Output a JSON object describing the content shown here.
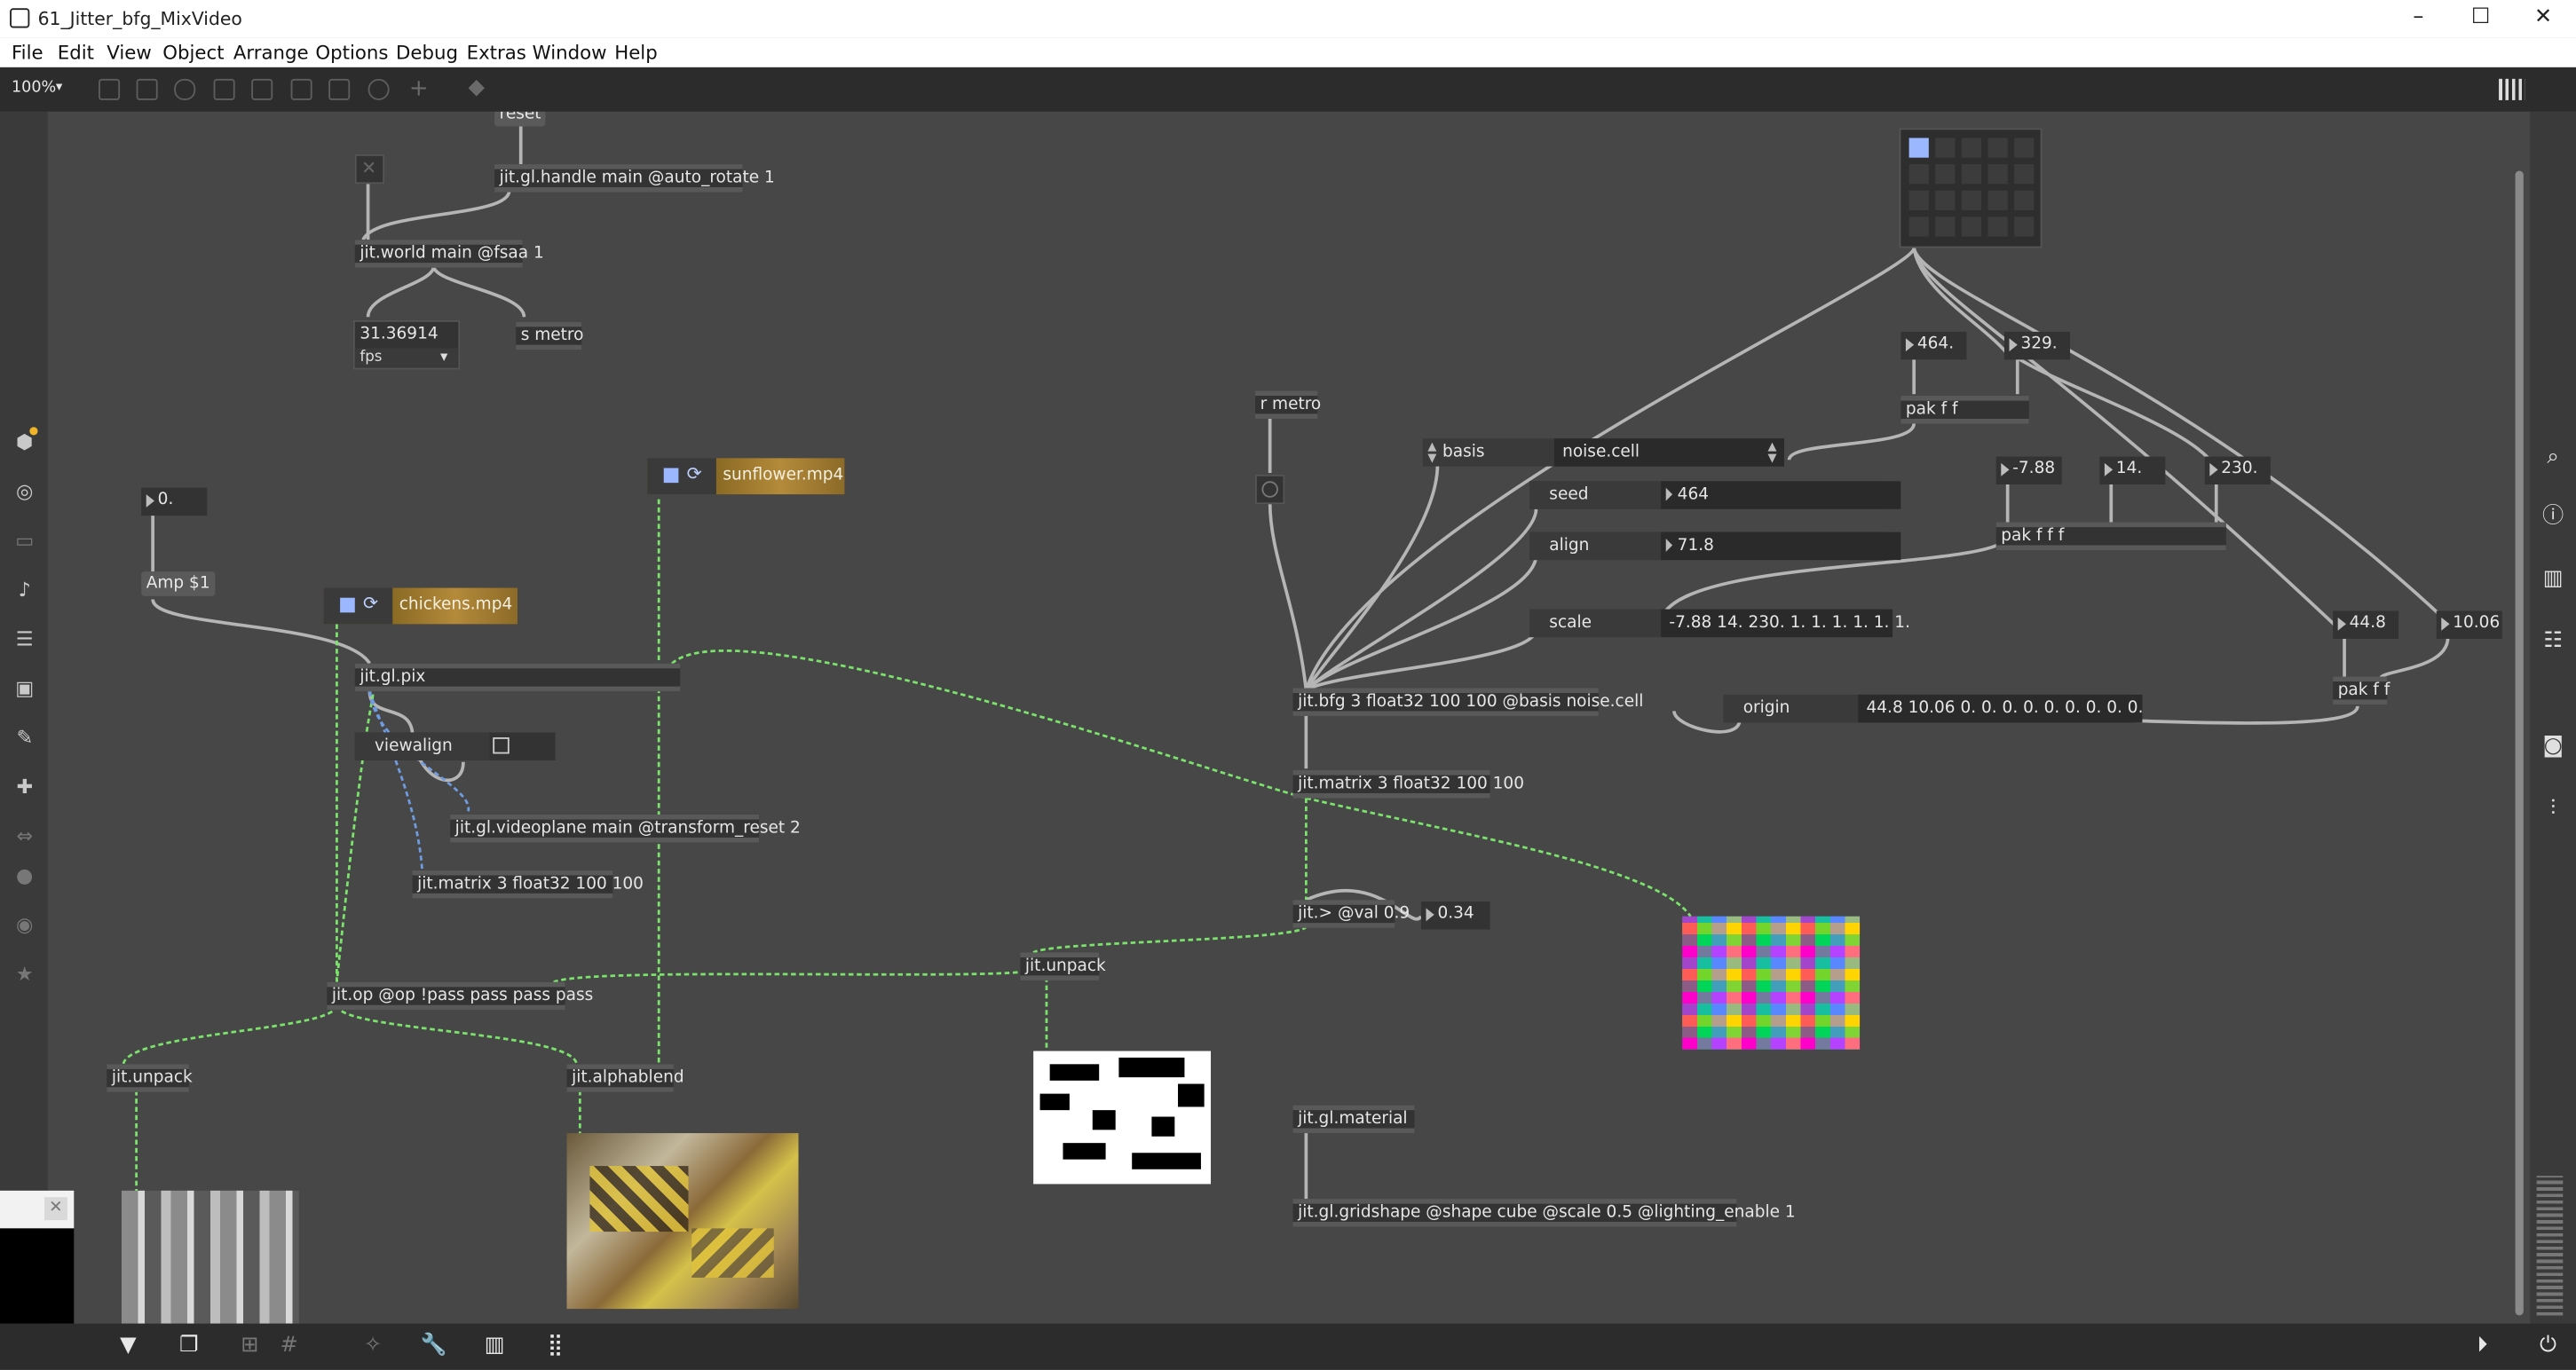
{
  "window": {
    "title": "61_Jitter_bfg_MixVideo",
    "buttons": [
      "–",
      "☐",
      "✕"
    ]
  },
  "menubar": [
    "File",
    "Edit",
    "View",
    "Object",
    "Arrange",
    "Options",
    "Debug",
    "Extras",
    "Window",
    "Help"
  ],
  "toolbar": {
    "zoom": "100%"
  },
  "objects": {
    "reset": "reset",
    "handle": "jit.gl.handle main @auto_rotate 1",
    "world": "jit.world main @fsaa 1",
    "fps_value": "31.36914",
    "fps_label": "fps",
    "s_metro": "s metro",
    "num_zero": "0.",
    "amp": "Amp $1",
    "sunflower": "sunflower.mp4",
    "chickens": "chickens.mp4",
    "pix": "jit.gl.pix",
    "viewalign": "viewalign",
    "videoplane": "jit.gl.videoplane main @transform_reset 2",
    "matrix_left": "jit.matrix 3 float32 100 100",
    "op": "jit.op @op !pass pass pass pass",
    "unpack_left": "jit.unpack",
    "alphablend": "jit.alphablend",
    "unpack_mid": "jit.unpack",
    "r_metro": "r metro",
    "basis_label": "basis",
    "basis_value": "noise.cell",
    "seed_label": "seed",
    "seed_value": "464",
    "align_label": "align",
    "align_value": "71.8",
    "scale_label": "scale",
    "scale_value": "-7.88 14. 230. 1. 1. 1. 1. 1. 1.",
    "bfg": "jit.bfg 3 float32 100 100 @basis noise.cell",
    "origin_label": "origin",
    "origin_value": "44.8 10.06 0. 0. 0. 0. 0. 0. 0. 0. 0.",
    "matrix_mid": "jit.matrix 3 float32 100 100",
    "gtval": "jit.> @val 0.9",
    "num_034": "0.34",
    "material": "jit.gl.material",
    "gridshape": "jit.gl.gridshape @shape cube @scale 0.5 @lighting_enable 1",
    "num_464": "464.",
    "num_329": "329.",
    "pakff_top": "pak f f",
    "num_m788": "-7.88",
    "num_14": "14.",
    "num_230": "230.",
    "pakfff": "pak f f f",
    "num_448": "44.8",
    "num_1006": "10.06",
    "pakff_right": "pak f f"
  },
  "colors": {
    "canvas": "#474747",
    "patchcord": "#b5b5b5",
    "signal_cord": "#7be36b",
    "matrix_cord": "#6f9ce0",
    "player": "#b48a3a",
    "accent": "#9ab7ff"
  },
  "icons": {
    "left": [
      "cube-icon",
      "target-icon",
      "tv-icon",
      "music-note-icon",
      "list-play-icon",
      "image-icon",
      "clip-icon",
      "plug-icon",
      "loop-icon",
      "vst-icon",
      "p-icon",
      "star-icon"
    ],
    "right": [
      "search-icon",
      "info-icon",
      "split-icon",
      "list-icon",
      "camera-icon",
      "sliders-icon"
    ],
    "bottom": [
      "comment-icon",
      "window-icon",
      "grid-toggle-icon",
      "grid-icon",
      "pin-icon",
      "wrench-icon",
      "piano-icon",
      "keyboard-icon",
      "play-circle-icon",
      "power-icon"
    ]
  }
}
